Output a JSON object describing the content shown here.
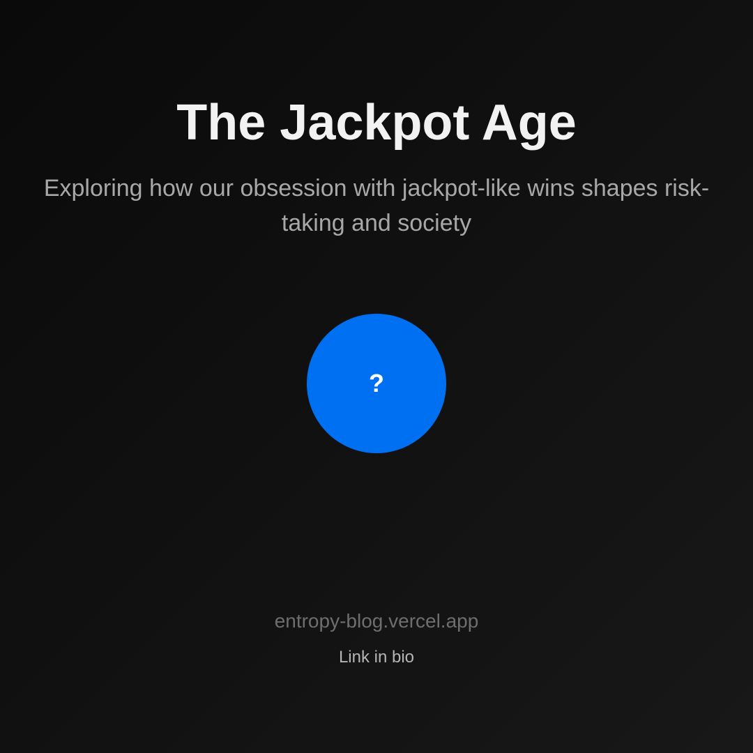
{
  "title": "The Jackpot Age",
  "subtitle": "Exploring how our obsession with jackpot-like wins shapes risk-taking and society",
  "badge": {
    "symbol": "?",
    "icon": "question-mark-icon",
    "color": "#0070f3"
  },
  "footer": {
    "url": "entropy-blog.vercel.app",
    "cta": "Link in bio"
  }
}
